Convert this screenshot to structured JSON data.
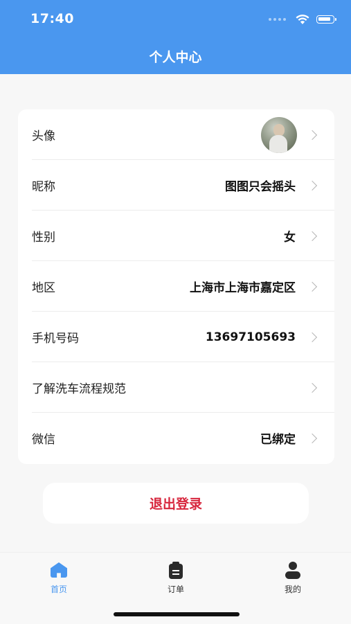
{
  "status_bar": {
    "time": "17:40"
  },
  "header": {
    "title": "个人中心"
  },
  "profile": {
    "rows": [
      {
        "label": "头像",
        "value": ""
      },
      {
        "label": "昵称",
        "value": "图图只会摇头"
      },
      {
        "label": "性别",
        "value": "女"
      },
      {
        "label": "地区",
        "value": "上海市上海市嘉定区"
      },
      {
        "label": "手机号码",
        "value": "13697105693"
      },
      {
        "label": "了解洗车流程规范",
        "value": ""
      },
      {
        "label": "微信",
        "value": "已绑定"
      }
    ]
  },
  "logout": {
    "label": "退出登录"
  },
  "tabbar": {
    "tabs": [
      {
        "label": "首页",
        "icon": "home-icon",
        "active": true
      },
      {
        "label": "订单",
        "icon": "clipboard-icon",
        "active": false
      },
      {
        "label": "我的",
        "icon": "user-icon",
        "active": false
      }
    ]
  },
  "colors": {
    "primary": "#4a97ef",
    "logout_text": "#d7263d",
    "background": "#f7f7f7"
  }
}
